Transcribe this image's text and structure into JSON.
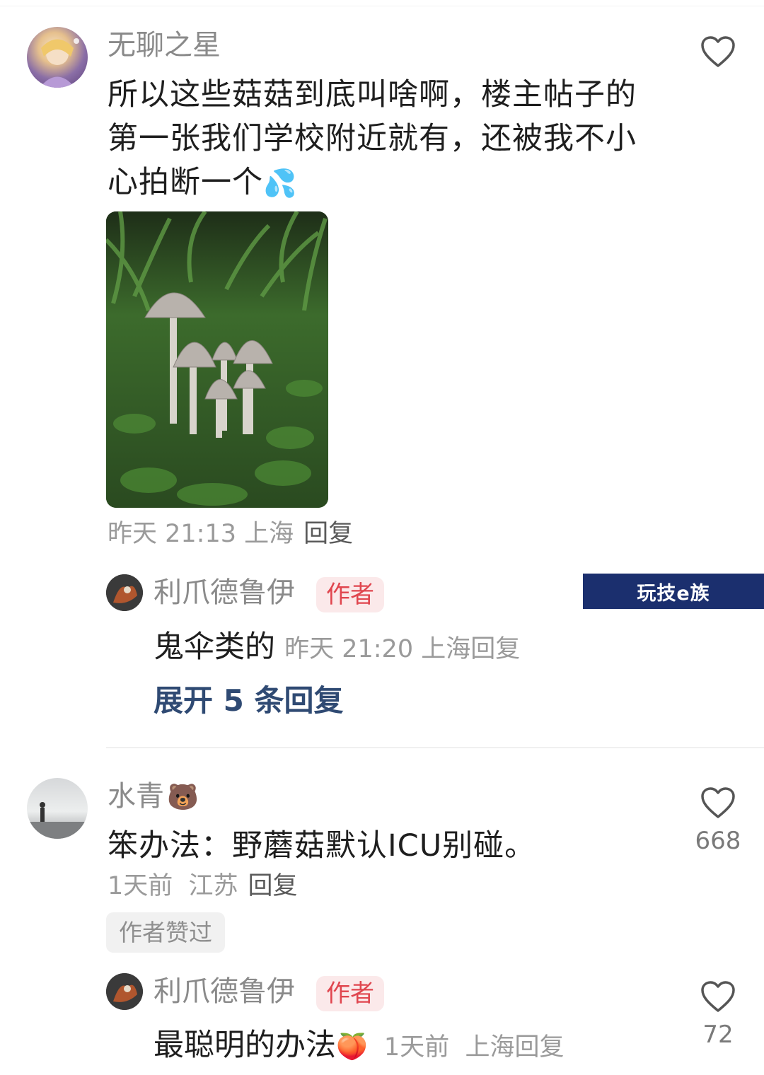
{
  "comments": [
    {
      "username": "无聊之星",
      "text": "所以这些菇菇到底叫啥啊，楼主帖子的第一张我们学校附近就有，还被我不小心拍断一个",
      "emoji": "💦",
      "meta": "昨天 21:13 上海",
      "reply_label": "回复",
      "replies": [
        {
          "username": "利爪德鲁伊",
          "author_tag": "作者",
          "text": "鬼伞类的",
          "meta": "昨天 21:20 上海",
          "reply_label": "回复"
        }
      ],
      "expand_label": "展开 5 条回复"
    },
    {
      "username": "水青",
      "name_emoji": "🐻",
      "text": "笨办法：野蘑菇默认ICU别碰。",
      "meta": "1天前  江苏",
      "reply_label": "回复",
      "like_count": "668",
      "liked_badge": "作者赞过",
      "replies": [
        {
          "username": "利爪德鲁伊",
          "author_tag": "作者",
          "text": "最聪明的办法",
          "emoji": "🍑",
          "meta": "1天前  上海",
          "reply_label": "回复",
          "like_count": "72"
        }
      ]
    }
  ],
  "watermark": "玩技e族",
  "colors": {
    "author_tag_bg": "#fbe9ea",
    "author_tag_text": "#e0464f",
    "expand_text": "#2f4a73",
    "watermark_bg": "#1b2f6e"
  }
}
